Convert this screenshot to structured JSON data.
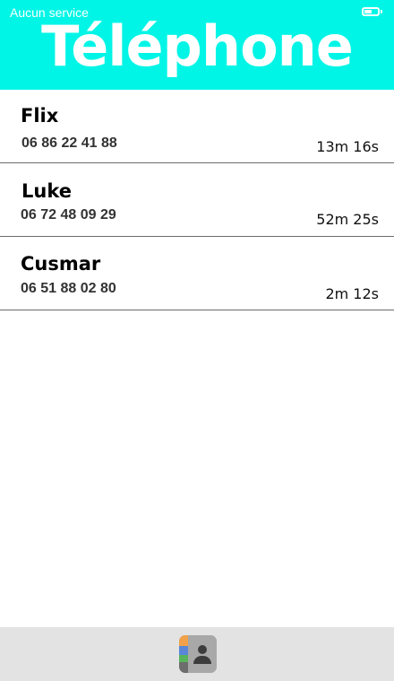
{
  "status_bar": {
    "carrier": "Aucun service",
    "battery_level": 0.6
  },
  "header": {
    "title": "Téléphone"
  },
  "calls": [
    {
      "name": "Flix",
      "number": "06 86 22 41 88",
      "duration": "13m 16s"
    },
    {
      "name": "Luke",
      "number": "06 72 48 09 29",
      "duration": "52m 25s"
    },
    {
      "name": "Cusmar",
      "number": "06 51 88 02 80",
      "duration": "2m 12s"
    }
  ],
  "tabbar": {
    "contacts_icon": "contacts-icon"
  },
  "colors": {
    "header_bg": "#00f5e6",
    "tabbar_bg": "#e3e3e3",
    "divider": "#6b6b6b"
  }
}
